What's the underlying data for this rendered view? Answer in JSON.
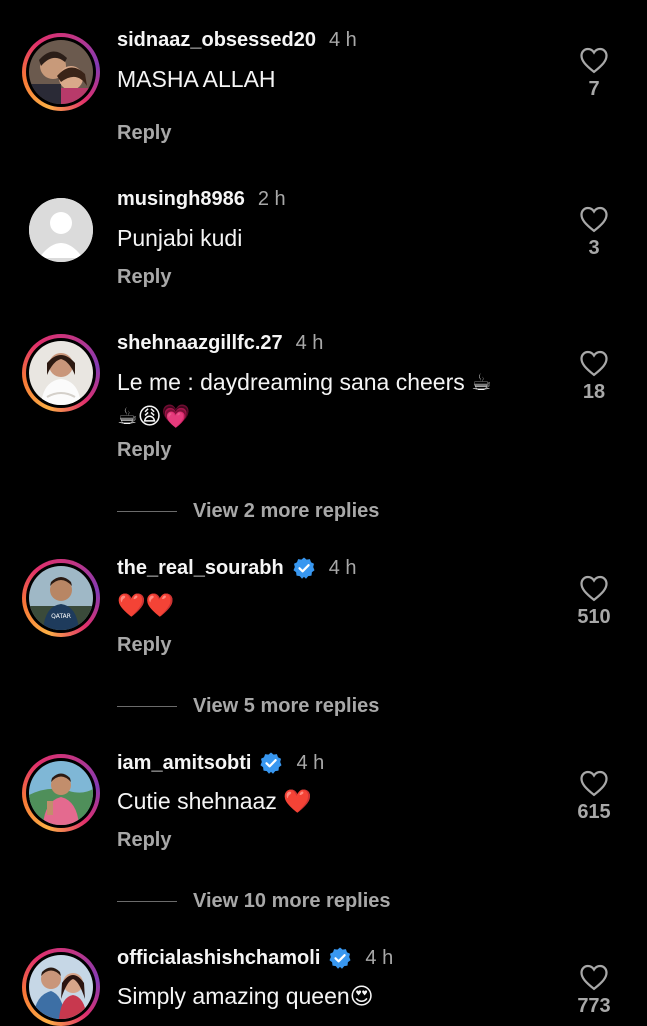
{
  "comments": [
    {
      "username": "sidnaaz_obsessed20",
      "time": "4 h",
      "text": "MASHA ALLAH",
      "reply_label": "Reply",
      "likes": "7",
      "verified": false,
      "avatar": "sidnaaz-couple-photo"
    },
    {
      "username": "musingh8986",
      "time": "2 h",
      "text": "Punjabi kudi",
      "reply_label": "Reply",
      "likes": "3",
      "verified": false,
      "avatar": "default-profile"
    },
    {
      "username": "shehnaazgillfc.27",
      "time": "4 h",
      "text_line1": "Le me : daydreaming sana cheers ☕",
      "text_line2": "☕😩💗",
      "reply_label": "Reply",
      "likes": "18",
      "verified": false,
      "avatar": "woman-white-outfit"
    },
    {
      "username": "the_real_sourabh",
      "time": "4 h",
      "text": "❤️❤️",
      "reply_label": "Reply",
      "likes": "510",
      "verified": true,
      "avatar": "man-in-car"
    },
    {
      "username": "iam_amitsobti",
      "time": "4 h",
      "text": "Cutie shehnaaz ❤️",
      "reply_label": "Reply",
      "likes": "615",
      "verified": true,
      "avatar": "man-outdoors"
    },
    {
      "username": "officialashishchamoli",
      "time": "4 h",
      "text": "Simply amazing queen😍",
      "likes": "773",
      "verified": true,
      "avatar": "couple-photo"
    }
  ],
  "view_more": [
    {
      "label": "View 2 more replies"
    },
    {
      "label": "View 5 more replies"
    },
    {
      "label": "View 10 more replies"
    }
  ],
  "colors": {
    "background": "#000000",
    "text": "#f5f5f5",
    "secondary": "#a8a8a8",
    "verified": "#3897f0"
  },
  "icons": {
    "like": "heart-outline-icon",
    "verified": "verified-badge-icon"
  }
}
